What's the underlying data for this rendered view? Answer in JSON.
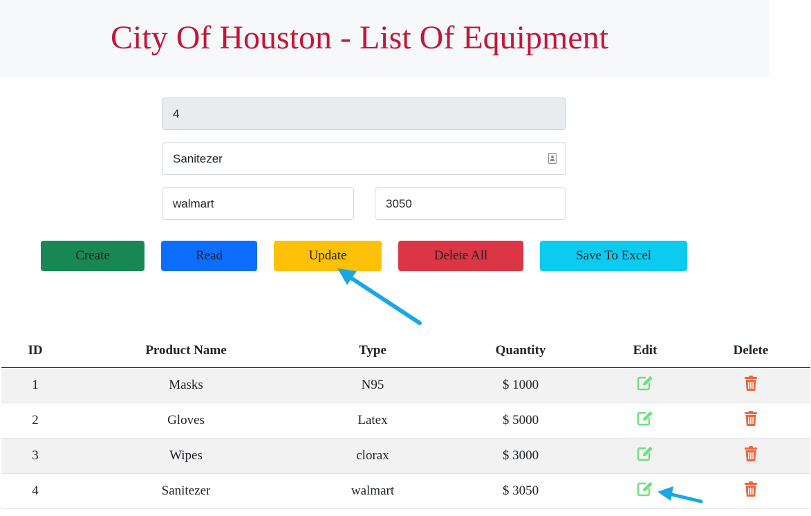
{
  "header": {
    "title": "City Of Houston - List Of Equipment"
  },
  "form": {
    "id_value": "4",
    "name_value": "Sanitezer",
    "type_value": "walmart",
    "quantity_value": "3050"
  },
  "buttons": {
    "create": "Create",
    "read": "Read",
    "update": "Update",
    "delete_all": "Delete All",
    "save_excel": "Save To Excel"
  },
  "table": {
    "headers": [
      "ID",
      "Product Name",
      "Type",
      "Quantity",
      "Edit",
      "Delete"
    ],
    "rows": [
      {
        "id": "1",
        "name": "Masks",
        "type": "N95",
        "quantity": "$ 1000"
      },
      {
        "id": "2",
        "name": "Gloves",
        "type": "Latex",
        "quantity": "$ 5000"
      },
      {
        "id": "3",
        "name": "Wipes",
        "type": "clorax",
        "quantity": "$ 3000"
      },
      {
        "id": "4",
        "name": "Sanitezer",
        "type": "walmart",
        "quantity": "$ 3050"
      }
    ]
  },
  "colors": {
    "title": "#c3163a",
    "edit_icon": "#6ee07f",
    "delete_icon": "#f0653c",
    "annotation_arrow": "#1aa7e6"
  },
  "icons": {
    "edit": "edit-icon",
    "delete": "trash-icon",
    "autofill": "contact-card-icon"
  }
}
